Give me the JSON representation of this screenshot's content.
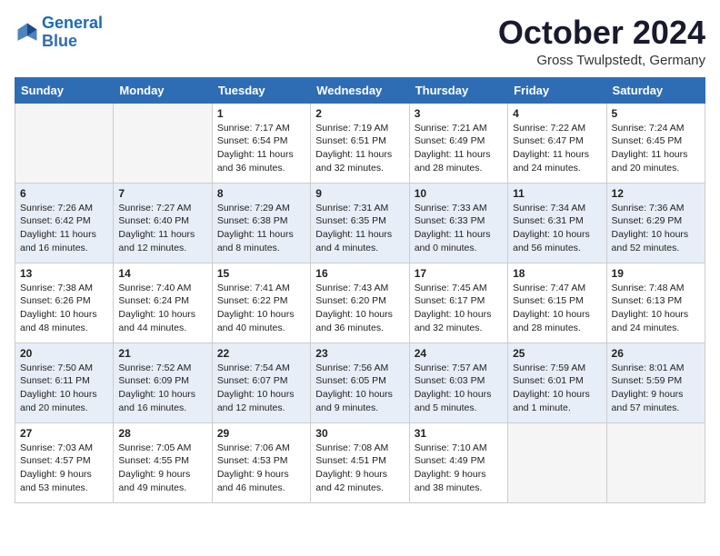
{
  "header": {
    "logo_line1": "General",
    "logo_line2": "Blue",
    "month": "October 2024",
    "location": "Gross Twulpstedt, Germany"
  },
  "days_of_week": [
    "Sunday",
    "Monday",
    "Tuesday",
    "Wednesday",
    "Thursday",
    "Friday",
    "Saturday"
  ],
  "weeks": [
    [
      {
        "day": "",
        "content": ""
      },
      {
        "day": "",
        "content": ""
      },
      {
        "day": "1",
        "content": "Sunrise: 7:17 AM\nSunset: 6:54 PM\nDaylight: 11 hours and 36 minutes."
      },
      {
        "day": "2",
        "content": "Sunrise: 7:19 AM\nSunset: 6:51 PM\nDaylight: 11 hours and 32 minutes."
      },
      {
        "day": "3",
        "content": "Sunrise: 7:21 AM\nSunset: 6:49 PM\nDaylight: 11 hours and 28 minutes."
      },
      {
        "day": "4",
        "content": "Sunrise: 7:22 AM\nSunset: 6:47 PM\nDaylight: 11 hours and 24 minutes."
      },
      {
        "day": "5",
        "content": "Sunrise: 7:24 AM\nSunset: 6:45 PM\nDaylight: 11 hours and 20 minutes."
      }
    ],
    [
      {
        "day": "6",
        "content": "Sunrise: 7:26 AM\nSunset: 6:42 PM\nDaylight: 11 hours and 16 minutes."
      },
      {
        "day": "7",
        "content": "Sunrise: 7:27 AM\nSunset: 6:40 PM\nDaylight: 11 hours and 12 minutes."
      },
      {
        "day": "8",
        "content": "Sunrise: 7:29 AM\nSunset: 6:38 PM\nDaylight: 11 hours and 8 minutes."
      },
      {
        "day": "9",
        "content": "Sunrise: 7:31 AM\nSunset: 6:35 PM\nDaylight: 11 hours and 4 minutes."
      },
      {
        "day": "10",
        "content": "Sunrise: 7:33 AM\nSunset: 6:33 PM\nDaylight: 11 hours and 0 minutes."
      },
      {
        "day": "11",
        "content": "Sunrise: 7:34 AM\nSunset: 6:31 PM\nDaylight: 10 hours and 56 minutes."
      },
      {
        "day": "12",
        "content": "Sunrise: 7:36 AM\nSunset: 6:29 PM\nDaylight: 10 hours and 52 minutes."
      }
    ],
    [
      {
        "day": "13",
        "content": "Sunrise: 7:38 AM\nSunset: 6:26 PM\nDaylight: 10 hours and 48 minutes."
      },
      {
        "day": "14",
        "content": "Sunrise: 7:40 AM\nSunset: 6:24 PM\nDaylight: 10 hours and 44 minutes."
      },
      {
        "day": "15",
        "content": "Sunrise: 7:41 AM\nSunset: 6:22 PM\nDaylight: 10 hours and 40 minutes."
      },
      {
        "day": "16",
        "content": "Sunrise: 7:43 AM\nSunset: 6:20 PM\nDaylight: 10 hours and 36 minutes."
      },
      {
        "day": "17",
        "content": "Sunrise: 7:45 AM\nSunset: 6:17 PM\nDaylight: 10 hours and 32 minutes."
      },
      {
        "day": "18",
        "content": "Sunrise: 7:47 AM\nSunset: 6:15 PM\nDaylight: 10 hours and 28 minutes."
      },
      {
        "day": "19",
        "content": "Sunrise: 7:48 AM\nSunset: 6:13 PM\nDaylight: 10 hours and 24 minutes."
      }
    ],
    [
      {
        "day": "20",
        "content": "Sunrise: 7:50 AM\nSunset: 6:11 PM\nDaylight: 10 hours and 20 minutes."
      },
      {
        "day": "21",
        "content": "Sunrise: 7:52 AM\nSunset: 6:09 PM\nDaylight: 10 hours and 16 minutes."
      },
      {
        "day": "22",
        "content": "Sunrise: 7:54 AM\nSunset: 6:07 PM\nDaylight: 10 hours and 12 minutes."
      },
      {
        "day": "23",
        "content": "Sunrise: 7:56 AM\nSunset: 6:05 PM\nDaylight: 10 hours and 9 minutes."
      },
      {
        "day": "24",
        "content": "Sunrise: 7:57 AM\nSunset: 6:03 PM\nDaylight: 10 hours and 5 minutes."
      },
      {
        "day": "25",
        "content": "Sunrise: 7:59 AM\nSunset: 6:01 PM\nDaylight: 10 hours and 1 minute."
      },
      {
        "day": "26",
        "content": "Sunrise: 8:01 AM\nSunset: 5:59 PM\nDaylight: 9 hours and 57 minutes."
      }
    ],
    [
      {
        "day": "27",
        "content": "Sunrise: 7:03 AM\nSunset: 4:57 PM\nDaylight: 9 hours and 53 minutes."
      },
      {
        "day": "28",
        "content": "Sunrise: 7:05 AM\nSunset: 4:55 PM\nDaylight: 9 hours and 49 minutes."
      },
      {
        "day": "29",
        "content": "Sunrise: 7:06 AM\nSunset: 4:53 PM\nDaylight: 9 hours and 46 minutes."
      },
      {
        "day": "30",
        "content": "Sunrise: 7:08 AM\nSunset: 4:51 PM\nDaylight: 9 hours and 42 minutes."
      },
      {
        "day": "31",
        "content": "Sunrise: 7:10 AM\nSunset: 4:49 PM\nDaylight: 9 hours and 38 minutes."
      },
      {
        "day": "",
        "content": ""
      },
      {
        "day": "",
        "content": ""
      }
    ]
  ]
}
